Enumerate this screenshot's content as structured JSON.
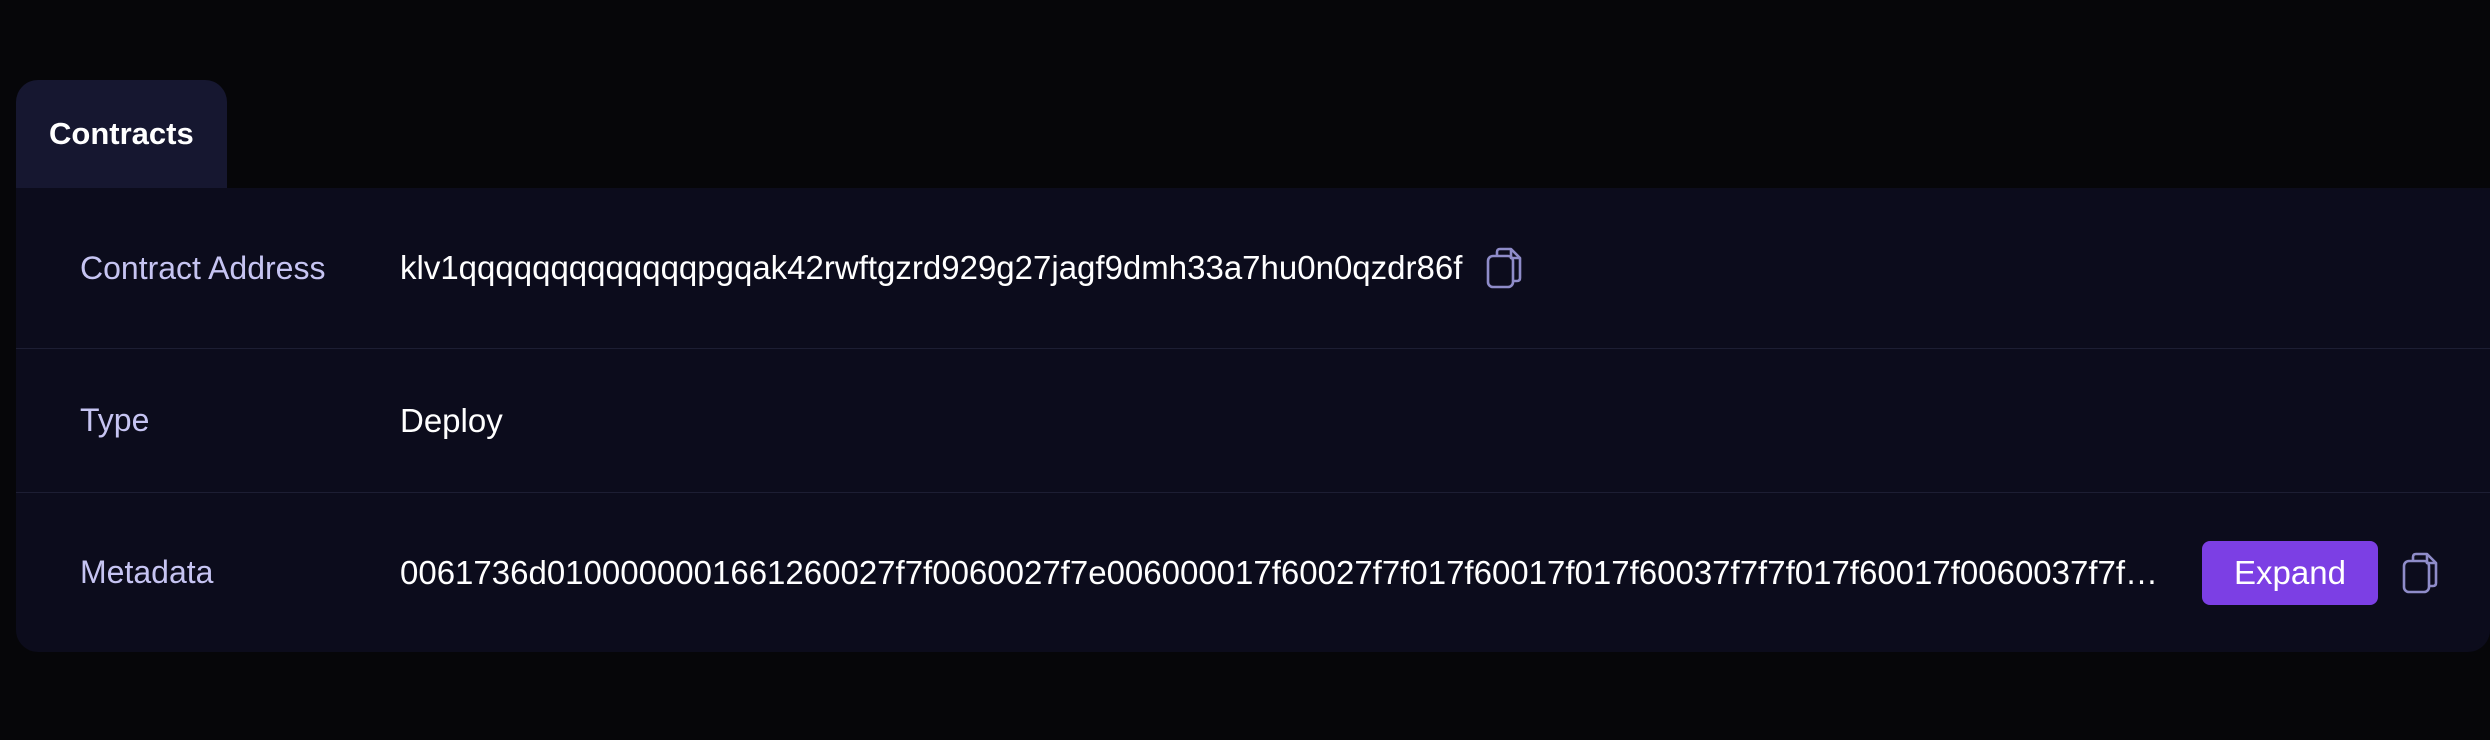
{
  "tabs": [
    {
      "label": "Contracts",
      "active": true
    }
  ],
  "rows": {
    "contract_address": {
      "label": "Contract Address",
      "value": "klv1qqqqqqqqqqqqqpgqak42rwftgzrd929g27jagf9dmh33a7hu0n0qzdr86f",
      "copy_icon": "copy-icon"
    },
    "type": {
      "label": "Type",
      "value": "Deploy"
    },
    "metadata": {
      "label": "Metadata",
      "value": "0061736d0100000001661260027f7f0060027f7e006000017f60027f7f017f60017f017f60037f7f7f017f60017f0060037f7f…",
      "expand_label": "Expand",
      "copy_icon": "copy-icon"
    }
  },
  "colors": {
    "background": "#060609",
    "panel": "#0c0c1c",
    "tab": "#161730",
    "label": "#c6c4f2",
    "accent": "#7c3fe4",
    "icon": "#8f8cc9"
  }
}
